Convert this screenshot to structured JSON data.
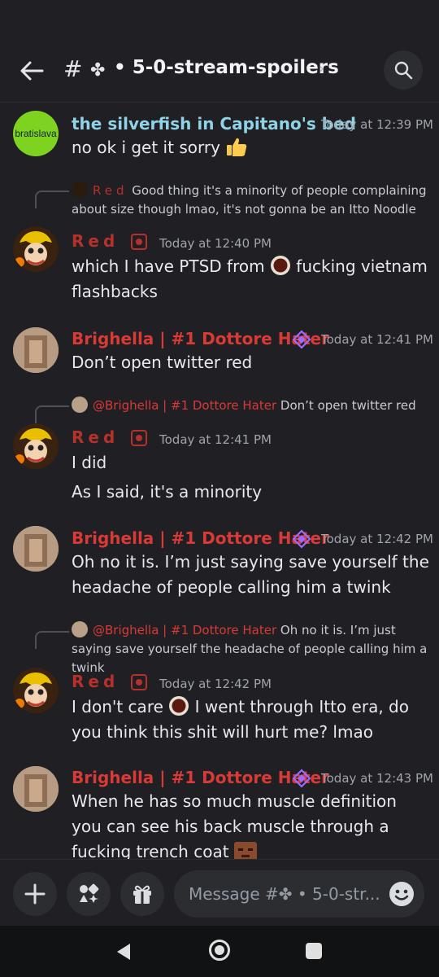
{
  "header": {
    "hash": "#",
    "clover": "✤",
    "channel": "• 5-0-stream-spoilers",
    "chevron": "›"
  },
  "messages": {
    "m1": {
      "avatar_text": "bratislava",
      "author": "the silverfish in Capitano's bed",
      "time": "Today at 12:39 PM",
      "text": "no ok i get it sorry"
    },
    "m2": {
      "reply_author": "Red",
      "reply_text": "Good thing it's a minority of people complaining about size though lmao, it's not gonna be an Itto Noodle",
      "author": "Red",
      "time": "Today at 12:40 PM",
      "text_a": "which I have PTSD from",
      "text_b": "fucking vietnam flashbacks"
    },
    "m3": {
      "author": "Brighella | #1 Dottore Hater",
      "time": "Today at 12:41 PM",
      "text": "Don’t open twitter red"
    },
    "m4": {
      "reply_author": "@Brighella | #1 Dottore Hater",
      "reply_text": "Don’t open twitter red",
      "author": "Red",
      "time": "Today at 12:41 PM",
      "line1": "I did",
      "line2": "As I said, it's a minority"
    },
    "m5": {
      "author": "Brighella | #1 Dottore Hater",
      "time": "Today at 12:42 PM",
      "text": "Oh no it is. I’m just saying save yourself the headache of people calling him a twink"
    },
    "m6": {
      "reply_author": "@Brighella | #1 Dottore Hater",
      "reply_text": "Oh no it is. I’m just saying save yourself the headache of people calling him a twink",
      "author": "Red",
      "time": "Today at 12:42 PM",
      "text_a": "I don't care",
      "text_b": "I went through Itto era, do you think this shit will hurt me? lmao"
    },
    "m7": {
      "author": "Brighella | #1 Dottore Hater",
      "time": "Today at 12:43 PM",
      "text": "When he has so much muscle definition you can see his back muscle through a fucking trench coat"
    }
  },
  "composer": {
    "placeholder": "Message #✤ • 5-0-str..."
  },
  "colors": {
    "background": "#1f1f24",
    "silverfish_name": "#8fd3e6",
    "red_name": "#b6312b",
    "brighella_name": "#d93a36",
    "role_icon": "#9b6bff"
  },
  "icons": [
    "back-arrow-icon",
    "search-icon",
    "thumbs-up-emoji",
    "clown-face-emoji",
    "role-diamond-icon",
    "reaction-sticker-icon",
    "plus-icon",
    "apps-icon",
    "gift-icon",
    "emoji-smile-icon",
    "nav-back-icon",
    "nav-home-icon",
    "nav-recents-icon"
  ]
}
